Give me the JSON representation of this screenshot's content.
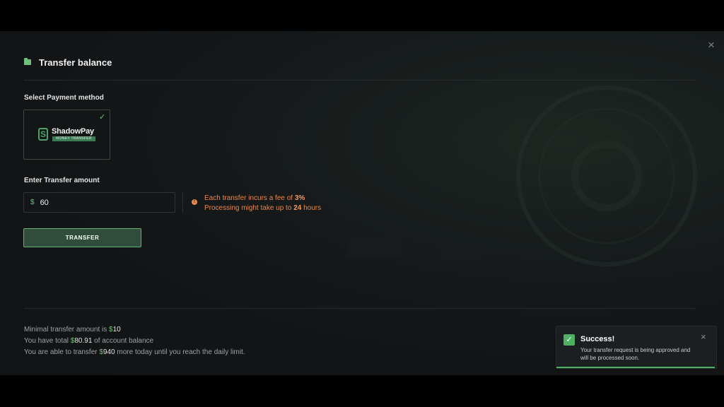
{
  "modal": {
    "title": "Transfer balance",
    "close_icon": "×"
  },
  "payment": {
    "label": "Select Payment method",
    "methods": [
      {
        "name": "ShadowPay",
        "subtitle": "MONEY TRANSFER",
        "logo_letter": "S",
        "selected": true,
        "check_icon": "✓"
      }
    ]
  },
  "amount": {
    "label": "Enter Transfer amount",
    "currency": "$",
    "value": "60"
  },
  "info": {
    "icon": "!",
    "fee_prefix": "Each transfer incurs a fee of ",
    "fee_value": "3%",
    "processing_prefix": "Processing might take up to ",
    "processing_value": "24",
    "processing_suffix": " hours"
  },
  "transfer_button": {
    "label": "TRANSFER"
  },
  "footer": {
    "min_prefix": "Minimal transfer amount is ",
    "min_currency": "$",
    "min_value": "10",
    "total_prefix": "You have total ",
    "total_currency": "$",
    "total_value": "80.91",
    "total_suffix": " of account balance",
    "able_prefix": "You are able to transfer ",
    "able_currency": "$",
    "able_value": "940",
    "able_suffix": " more today until you reach the daily limit."
  },
  "toast": {
    "check_icon": "✓",
    "title": "Success!",
    "message": "Your transfer request is being approved and will be processed soon.",
    "close_icon": "×"
  },
  "colors": {
    "accent": "#6ec27a",
    "warning": "#e8874a",
    "background": "#131618"
  },
  "icons": {
    "title": "wallet-icon",
    "close": "close-icon",
    "selected": "check-icon",
    "info": "info-icon",
    "toast": "success-check-icon"
  }
}
